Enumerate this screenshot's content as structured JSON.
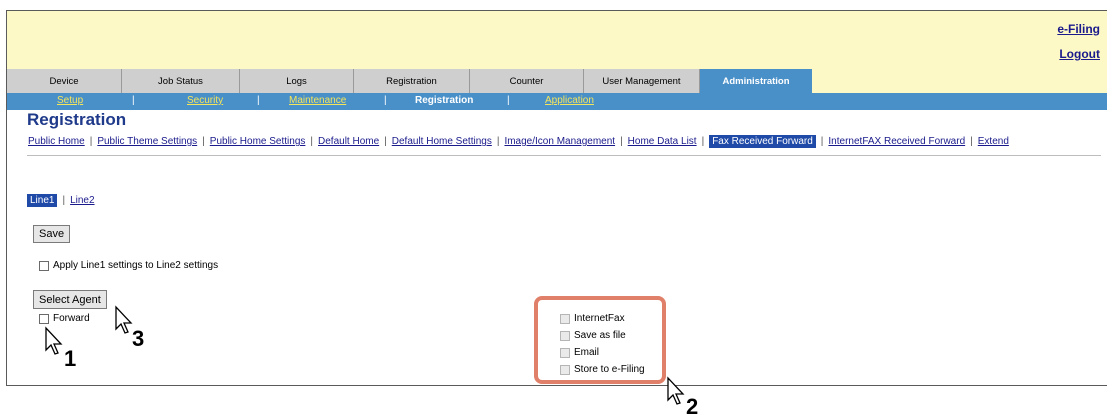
{
  "top_links": [
    "e-Filing",
    "Logout"
  ],
  "tabs": [
    "Device",
    "Job Status",
    "Logs",
    "Registration",
    "Counter",
    "User Management",
    "Administration"
  ],
  "active_tab": "Administration",
  "subnav": [
    "Setup",
    "Security",
    "Maintenance",
    "Registration",
    "Application"
  ],
  "active_subnav": "Registration",
  "subnav_sep": "|",
  "page_title": "Registration",
  "links": [
    "Public Home",
    "Public Theme Settings",
    "Public Home Settings",
    "Default Home",
    "Default Home Settings",
    "Image/Icon Management",
    "Home Data List",
    "Fax Received Forward",
    "InternetFAX Received Forward",
    "Extend"
  ],
  "active_link": "Fax Received Forward",
  "link_sep": "|",
  "line_tabs": [
    "Line1",
    "Line2"
  ],
  "active_line": "Line1",
  "save_label": "Save",
  "apply_label": "Apply Line1 settings to Line2 settings",
  "select_agent_label": "Select Agent",
  "forward_label": "Forward",
  "agents": [
    "InternetFax",
    "Save as file",
    "Email",
    "Store to e-Filing"
  ],
  "callouts": [
    "1",
    "2",
    "3"
  ],
  "colors": {
    "tab_active": "#4a90c8",
    "subnav_link": "#f5e55b",
    "title": "#1f3a8a",
    "highlight_box": "#e0806a",
    "top_bg": "#fdf9c6"
  }
}
